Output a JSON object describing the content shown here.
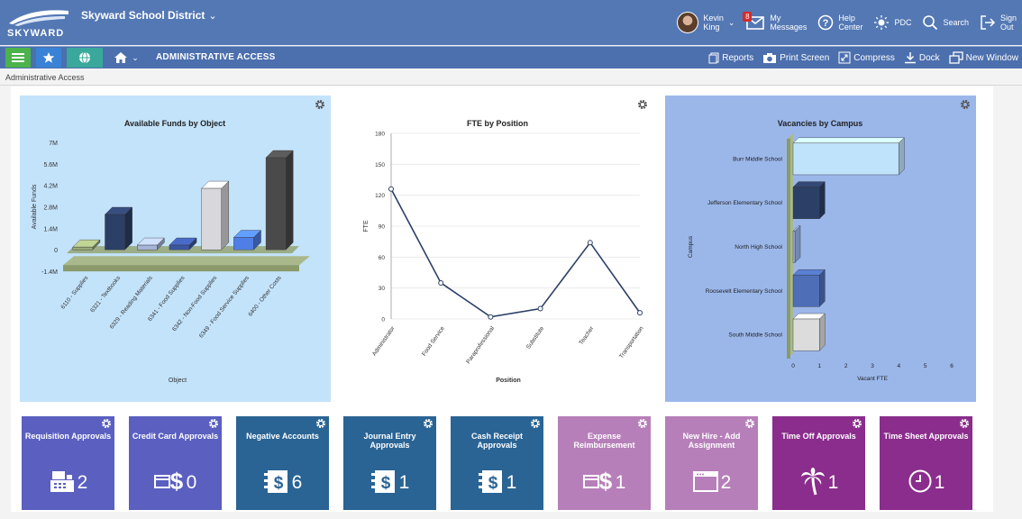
{
  "header": {
    "logo_text": "SKYWARD",
    "district": "Skyward School District",
    "user_first": "Kevin",
    "user_last": "King",
    "messages_badge": "8",
    "messages_l1": "My",
    "messages_l2": "Messages",
    "help_l1": "Help",
    "help_l2": "Center",
    "pdc": "PDC",
    "search": "Search",
    "signout_l1": "Sign",
    "signout_l2": "Out"
  },
  "navbar": {
    "title": "ADMINISTRATIVE ACCESS",
    "actions": [
      "Reports",
      "Print Screen",
      "Compress",
      "Dock",
      "New Window"
    ]
  },
  "breadcrumb": "Administrative Access",
  "colors": {
    "topbar": "#5478b4",
    "navbar": "#4c6fae",
    "chart1_bg": "#c3e3fb",
    "chart3_bg": "#9bb7ea",
    "tile_blue": "#5a5fc0",
    "tile_teal": "#2a6494",
    "tile_pink": "#b67fb9",
    "tile_purple": "#8a2d8c"
  },
  "chart_data": [
    {
      "type": "bar",
      "title": "Available Funds by Object",
      "xlabel": "Object",
      "ylabel": "Available Funds",
      "y_ticks": [
        "7M",
        "5.6M",
        "4.2M",
        "2.8M",
        "1.4M",
        "0",
        "-1.4M"
      ],
      "ylim": [
        -1400000,
        7000000
      ],
      "categories": [
        "6110 - Supplies",
        "6321 - Textbooks",
        "6329 - Reading Materials",
        "6341 - Food Supplies",
        "6342 - Non-Food Supplies",
        "6349 - Food Service Supplies",
        "6400 - Other Costs"
      ],
      "values": [
        0,
        2300000,
        300000,
        300000,
        4000000,
        800000,
        6000000
      ],
      "bar_colors": [
        "#9aaa78",
        "#2c3f66",
        "#a6b4d8",
        "#3b55a0",
        "#d8d8dc",
        "#4f7fe6",
        "#4a4a4a"
      ],
      "grid": false
    },
    {
      "type": "line",
      "title": "FTE by Position",
      "xlabel": "Position",
      "ylabel": "FTE",
      "y_ticks": [
        "180",
        "150",
        "120",
        "90",
        "60",
        "30",
        "0"
      ],
      "ylim": [
        0,
        180
      ],
      "categories": [
        "Administrator",
        "Food Service",
        "Paraprofessional",
        "Substitute",
        "Teacher",
        "Transportation"
      ],
      "values": [
        126,
        35,
        2,
        10,
        74,
        6
      ],
      "grid": true
    },
    {
      "type": "bar",
      "orientation": "horizontal",
      "title": "Vacancies by Campus",
      "xlabel": "Vacant FTE",
      "ylabel": "Campus",
      "x_ticks": [
        "0",
        "1",
        "2",
        "3",
        "4",
        "5",
        "6"
      ],
      "xlim": [
        0,
        6
      ],
      "categories": [
        "Burr Middle School",
        "Jefferson Elementary School",
        "North High School",
        "Roosevelt Elementary School",
        "South Middle School"
      ],
      "values": [
        4,
        1,
        0,
        1,
        1
      ],
      "bar_colors": [
        "#bfe3fb",
        "#2c3f66",
        "#9bb7ea",
        "#4e6fb8",
        "#dcdcdc"
      ],
      "grid": false
    }
  ],
  "tiles": [
    {
      "label": "Requisition Approvals",
      "count": "2",
      "icon": "register-icon",
      "color": "#5a5fc0"
    },
    {
      "label": "Credit Card Approvals",
      "count": "0",
      "icon": "card-dollar-icon",
      "color": "#5a5fc0"
    },
    {
      "label": "Negative Accounts",
      "count": "6",
      "icon": "ledger-dollar-icon",
      "color": "#2a6494"
    },
    {
      "label": "Journal Entry Approvals",
      "count": "1",
      "icon": "ledger-dollar-icon",
      "color": "#2a6494"
    },
    {
      "label": "Cash Receipt Approvals",
      "count": "1",
      "icon": "ledger-dollar-icon",
      "color": "#2a6494"
    },
    {
      "label": "Expense Reimbursement",
      "count": "1",
      "icon": "card-dollar-icon",
      "color": "#b67fb9"
    },
    {
      "label": "New Hire - Add Assignment",
      "count": "2",
      "icon": "window-icon",
      "color": "#b67fb9"
    },
    {
      "label": "Time Off Approvals",
      "count": "1",
      "icon": "palm-tree-icon",
      "color": "#8a2d8c"
    },
    {
      "label": "Time Sheet Approvals",
      "count": "1",
      "icon": "clock-icon",
      "color": "#8a2d8c"
    }
  ]
}
